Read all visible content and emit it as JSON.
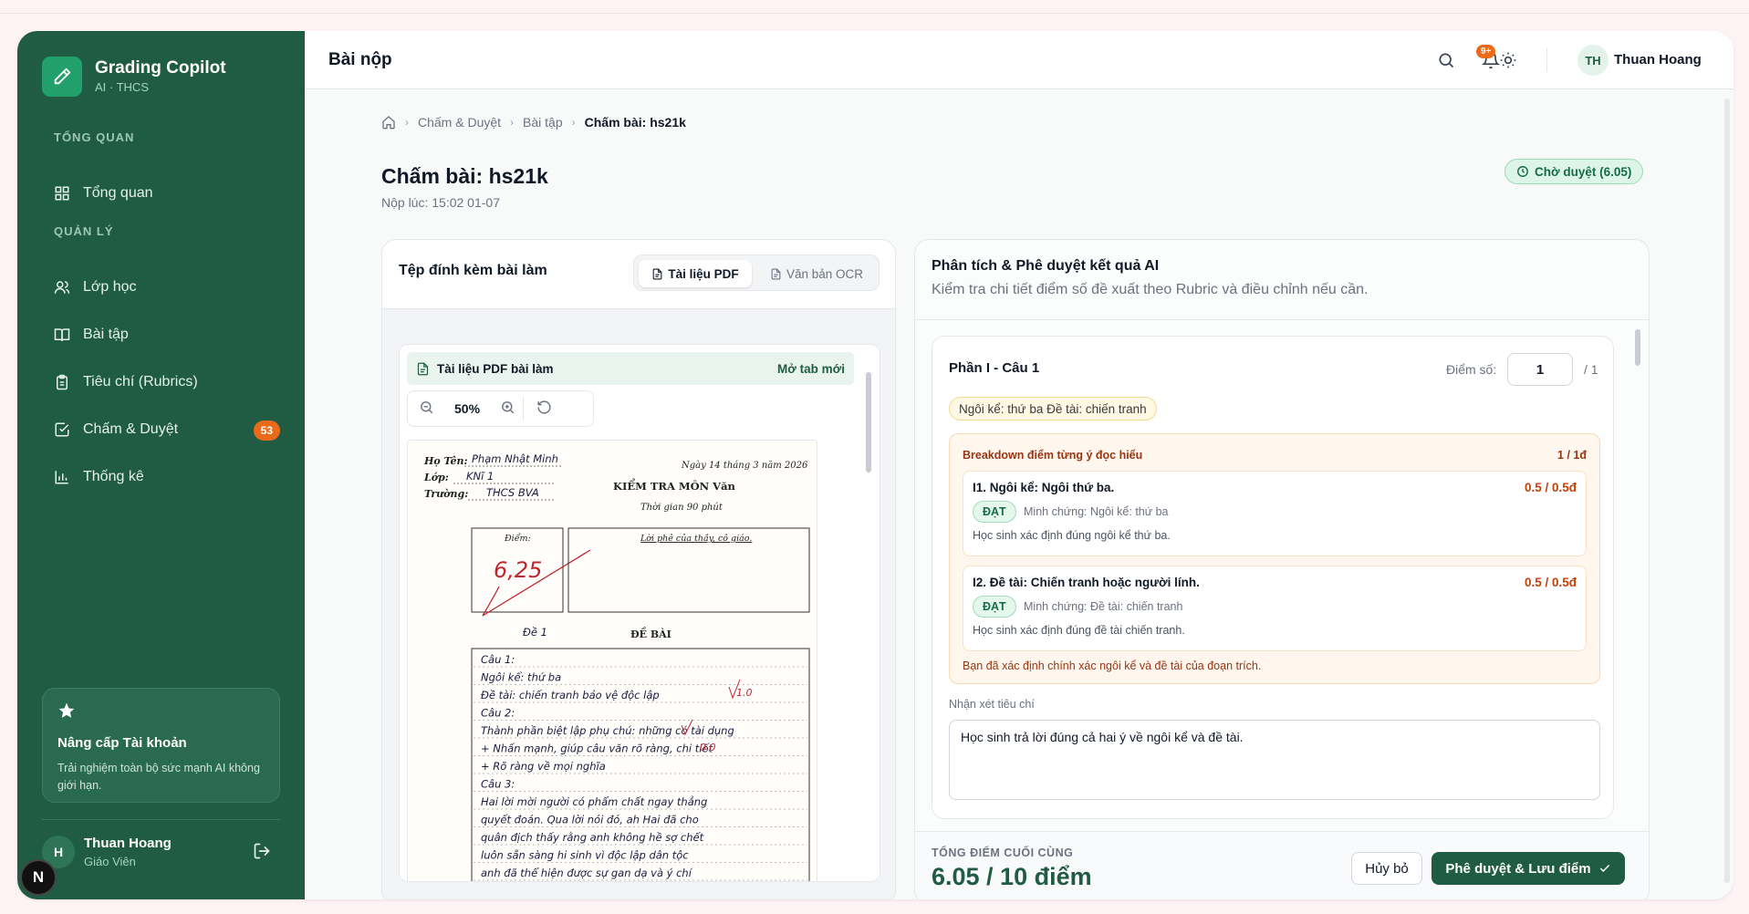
{
  "sidebar": {
    "brand": "Grading Copilot",
    "brand_sub": "AI · THCS",
    "section_overview": "TỔNG QUAN",
    "section_manage": "QUẢN LÝ",
    "items": [
      {
        "label": "Tổng quan",
        "icon": "dashboard-icon"
      },
      {
        "label": "Lớp học",
        "icon": "users-icon"
      },
      {
        "label": "Bài tập",
        "icon": "book-icon"
      },
      {
        "label": "Tiêu chí (Rubrics)",
        "icon": "clipboard-icon"
      },
      {
        "label": "Chấm & Duyệt",
        "icon": "check-square-icon",
        "badge": "53"
      },
      {
        "label": "Thống kê",
        "icon": "bar-chart-icon"
      }
    ],
    "upgrade": {
      "title": "Nâng cấp Tài khoản",
      "desc": "Trải nghiệm toàn bộ sức mạnh AI không giới hạn."
    },
    "user": {
      "initial": "H",
      "name": "Thuan Hoang",
      "role": "Giáo Viên"
    },
    "corner_logo": "N"
  },
  "header": {
    "title": "Bài nộp",
    "notif_badge": "9+",
    "user_initials": "TH",
    "user_name": "Thuan Hoang"
  },
  "breadcrumb": [
    "Chấm & Duyệt",
    "Bài tập",
    "Chấm bài: hs21k"
  ],
  "page": {
    "title": "Chấm bài: hs21k",
    "submitted": "Nộp lúc: 15:02 01-07",
    "status": "Chờ duyệt (6.05)"
  },
  "left_panel": {
    "title": "Tệp đính kèm bài làm",
    "tab_pdf": "Tài liệu PDF",
    "tab_ocr": "Văn bản OCR",
    "viewer_name": "Tài liệu PDF bài làm",
    "open_new_tab": "Mở tab mới",
    "zoom": "50%",
    "doc": {
      "name_label": "Họ Tên:",
      "name": "Phạm Nhật Minh",
      "class_label": "Lớp:",
      "class": "KNĩ 1",
      "school_label": "Trường:",
      "school": "THCS BVA",
      "date": "Ngày 14 tháng 3 năm 2026",
      "exam_title": "KIỂM TRA MÔN Văn",
      "time": "Thời gian 90 phút",
      "score_label": "Điểm:",
      "score": "6,25",
      "comment_label": "Lời phê của thầy, cô giáo.",
      "de": "Đề 1",
      "de_bai": "ĐỀ BÀI",
      "lines": [
        "Câu 1:",
        "Ngôi kể: thứ ba",
        "Đề tài: chiến tranh bảo vệ độc lập",
        "Câu 2:",
        "Thành phần biệt lập phụ chú: những có tài dụng",
        "+ Nhấn mạnh, giúp câu văn rõ ràng, chi tiết",
        "+ Rõ ràng về mọi nghĩa",
        "Câu 3:",
        "Hai lời mời người có phẩm chất ngay thẳng",
        "quyết đoán. Qua lời nói đó, ah Hai đã cho",
        "quân địch thấy rằng anh không hề sợ chết",
        "luôn sẵn sàng hi sinh vì độc lập dân tộc",
        "anh đã thể hiện được sự gan dạ và ý chí"
      ],
      "marks": [
        "1.0",
        "0.0"
      ]
    }
  },
  "right_panel": {
    "title": "Phân tích & Phê duyệt kết quả AI",
    "subtitle": "Kiểm tra chi tiết điểm số đề xuất theo Rubric và điều chỉnh nếu cần.",
    "question": "Phần I - Câu 1",
    "score_label": "Điểm số:",
    "score_value": "1",
    "score_max": "/ 1",
    "tag": "Ngôi kể: thứ ba Đề tài: chiến tranh",
    "breakdown_title": "Breakdown điểm từng ý đọc hiểu",
    "breakdown_score": "1 / 1đ",
    "items": [
      {
        "name": "I1. Ngôi kể: Ngôi thứ ba.",
        "score": "0.5 / 0.5đ",
        "status": "ĐẠT",
        "evidence": "Minh chứng: Ngôi kể: thứ ba",
        "explain": "Học sinh xác định đúng ngôi kể thứ ba."
      },
      {
        "name": "I2. Đề tài: Chiến tranh hoặc người lính.",
        "score": "0.5 / 0.5đ",
        "status": "ĐẠT",
        "evidence": "Minh chứng: Đề tài: chiến tranh",
        "explain": "Học sinh xác định đúng đề tài chiến tranh."
      }
    ],
    "breakdown_feedback": "Bạn đã xác định chính xác ngôi kể và đề tài của đoạn trích.",
    "comment_label": "Nhận xét tiêu chí",
    "comment": "Học sinh trả lời đúng cả hai ý về ngôi kể và đề tài.",
    "total_label": "TỔNG ĐIỂM CUỐI CÙNG",
    "total_value": "6.05 / 10 điểm",
    "cancel": "Hủy bỏ",
    "approve": "Phê duyệt & Lưu điểm"
  },
  "colors": {
    "sidebar": "#1f5c43",
    "accent": "#22a06b",
    "badge": "#ea6a1a",
    "status_bg": "#dcf5e8"
  }
}
